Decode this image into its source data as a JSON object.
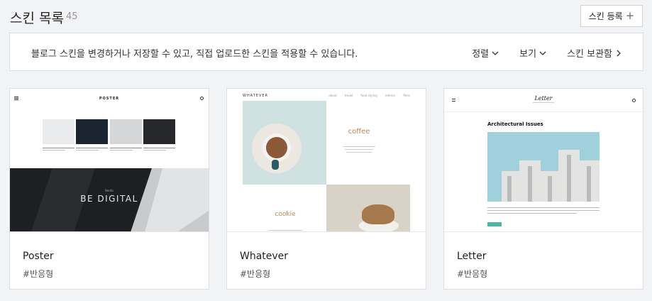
{
  "header": {
    "title": "스킨 목록",
    "count": "45",
    "register_label": "스킨 등록",
    "register_icon": "plus-icon"
  },
  "info": {
    "text": "블로그 스킨을 변경하거나 저장할 수 있고, 직접 업로드한 스킨을 적용할 수 있습니다.",
    "actions": [
      {
        "label": "정렬",
        "icon": "chevron-down-icon"
      },
      {
        "label": "보기",
        "icon": "chevron-down-icon"
      },
      {
        "label": "스킨 보관함",
        "icon": "chevron-right-icon"
      }
    ]
  },
  "skins": [
    {
      "name": "Poster",
      "tag": "#반응형",
      "thumb": {
        "logo": "POSTER",
        "hero_sub": "Bento",
        "hero_title": "BE DIGITAL"
      }
    },
    {
      "name": "Whatever",
      "tag": "#반응형",
      "thumb": {
        "logo": "WHATEVER",
        "nav": [
          "about",
          "travel",
          "food styling",
          "interior",
          "films"
        ],
        "heading1": "coffee",
        "heading2": "cookie"
      }
    },
    {
      "name": "Letter",
      "tag": "#반응형",
      "thumb": {
        "logo": "Letter",
        "post_title": "Architectural Issues"
      }
    }
  ]
}
